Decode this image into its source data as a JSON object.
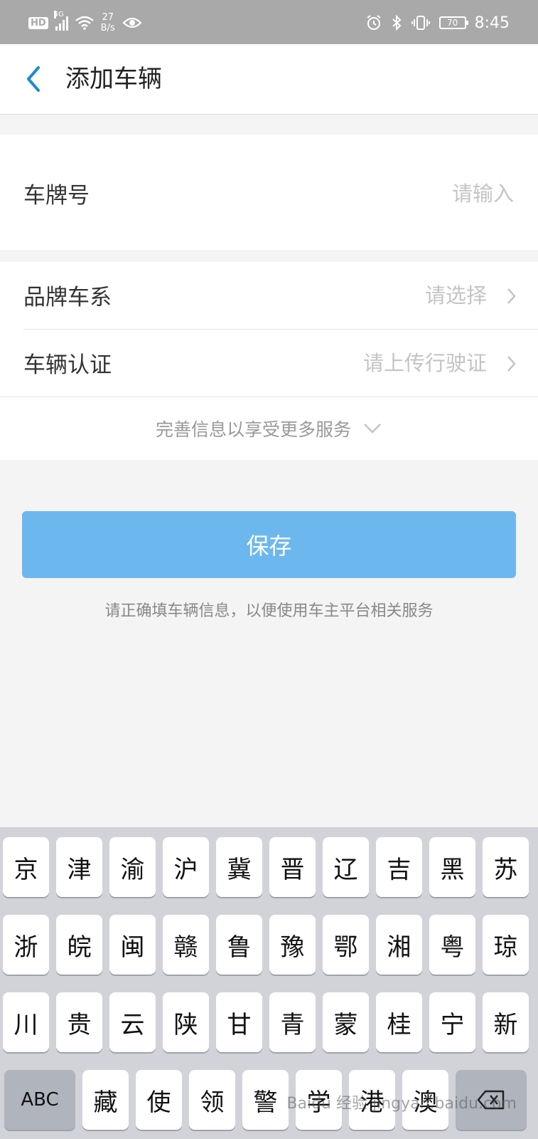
{
  "status_bar": {
    "hd": "HD",
    "network": "4G",
    "speed_value": "27",
    "speed_unit": "B/s",
    "battery": "70",
    "time": "8:45"
  },
  "header": {
    "title": "添加车辆"
  },
  "form": {
    "plate": {
      "label": "车牌号",
      "placeholder": "请输入"
    },
    "brand": {
      "label": "品牌车系",
      "placeholder": "请选择"
    },
    "cert": {
      "label": "车辆认证",
      "placeholder": "请上传行驶证"
    },
    "more": "完善信息以享受更多服务"
  },
  "save_label": "保存",
  "hint": "请正确填车辆信息，以便使用车主平台相关服务",
  "keyboard": {
    "row1": [
      "京",
      "津",
      "渝",
      "沪",
      "冀",
      "晋",
      "辽",
      "吉",
      "黑",
      "苏"
    ],
    "row2": [
      "浙",
      "皖",
      "闽",
      "赣",
      "鲁",
      "豫",
      "鄂",
      "湘",
      "粤",
      "琼"
    ],
    "row3": [
      "川",
      "贵",
      "云",
      "陕",
      "甘",
      "青",
      "蒙",
      "桂",
      "宁",
      "新"
    ],
    "abc_label": "ABC",
    "row4": [
      "藏",
      "使",
      "领",
      "警",
      "学",
      "港",
      "澳"
    ]
  },
  "watermark": "Baidu 经验 jingyan.baidu.com",
  "colors": {
    "accent": "#1e88d6",
    "save_button": "#6cb8ee",
    "status_bar": "#a9a9a9"
  }
}
